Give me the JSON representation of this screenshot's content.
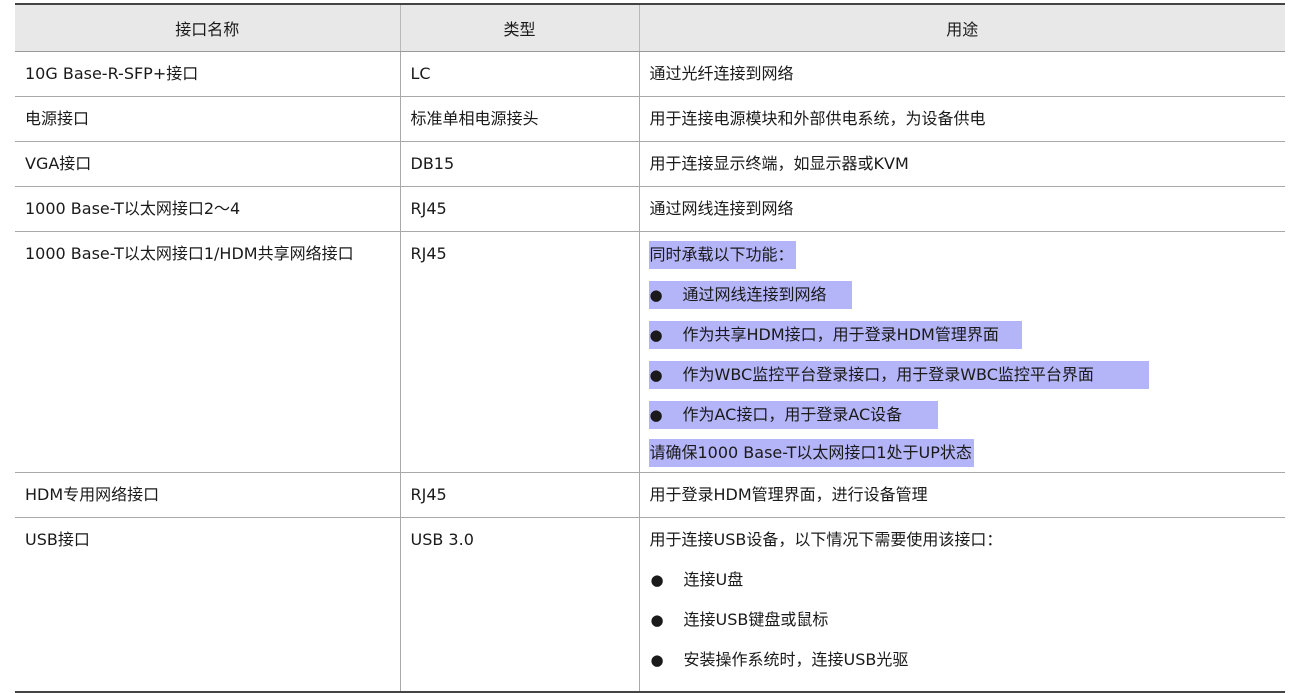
{
  "table": {
    "headers": [
      "接口名称",
      "类型",
      "用途"
    ],
    "rows": [
      {
        "name": "10G Base-R-SFP+接口",
        "type": "LC",
        "usage": "通过光纤连接到网络"
      },
      {
        "name": "电源接口",
        "type": "标准单相电源接头",
        "usage": "用于连接电源模块和外部供电系统，为设备供电"
      },
      {
        "name": "VGA接口",
        "type": "DB15",
        "usage": "用于连接显示终端，如显示器或KVM"
      },
      {
        "name": "1000 Base-T以太网接口2～4",
        "type": "RJ45",
        "usage": "通过网线连接到网络"
      },
      {
        "name": "1000 Base-T以太网接口1/HDM共享网络接口",
        "type": "RJ45",
        "usage_intro": "同时承载以下功能：",
        "usage_bullets": [
          "通过网线连接到网络",
          "作为共享HDM接口，用于登录HDM管理界面",
          "作为WBC监控平台登录接口，用于登录WBC监控平台界面",
          "作为AC接口，用于登录AC设备"
        ],
        "usage_note": "请确保1000 Base-T以太网接口1处于UP状态"
      },
      {
        "name": "HDM专用网络接口",
        "type": "RJ45",
        "usage": "用于登录HDM管理界面，进行设备管理"
      },
      {
        "name": "USB接口",
        "type": "USB 3.0",
        "usage_intro": "用于连接USB设备，以下情况下需要使用该接口：",
        "usage_bullets": [
          "连接U盘",
          "连接USB键盘或鼠标",
          "安装操作系统时，连接USB光驱"
        ]
      }
    ]
  },
  "bullet_glyph": "●",
  "highlight_color": "#b4b4f8"
}
